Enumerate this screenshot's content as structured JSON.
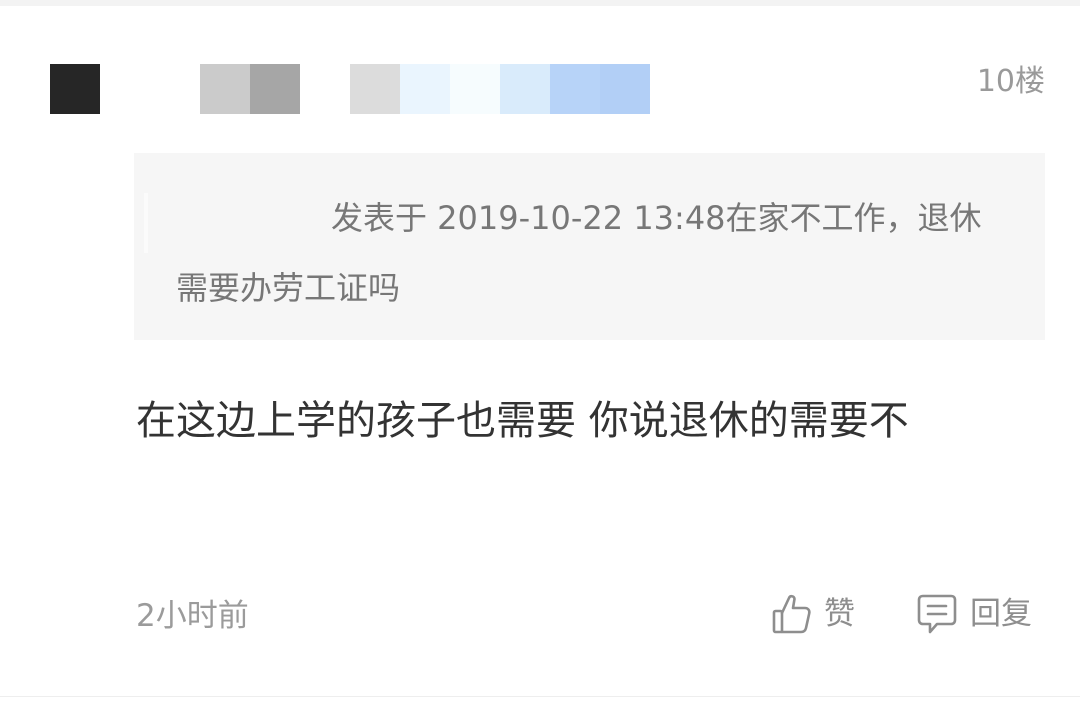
{
  "comment": {
    "floor_label": "10楼",
    "quote": {
      "text": "发表于 2019-10-22 13:48在家不工作，退休需要办劳工证吗"
    },
    "body": "在这边上学的孩子也需要 你说退休的需要不",
    "time": "2小时前",
    "actions": {
      "like_label": "赞",
      "reply_label": "回复",
      "like_icon": "thumbs-up-icon",
      "reply_icon": "comment-icon"
    }
  },
  "colors": {
    "avatar_placeholder": "#262626",
    "name_blur": [
      "#cbcbcb",
      "#a6a6a6"
    ],
    "badge_blur": [
      "#dcdcdc",
      "#eaf5fe",
      "#f6fcfe",
      "#d9ebfb",
      "#b7d3f8",
      "#b2cff6"
    ],
    "quote_background": "#f6f6f6",
    "secondary_text": "#9a9a9a"
  }
}
